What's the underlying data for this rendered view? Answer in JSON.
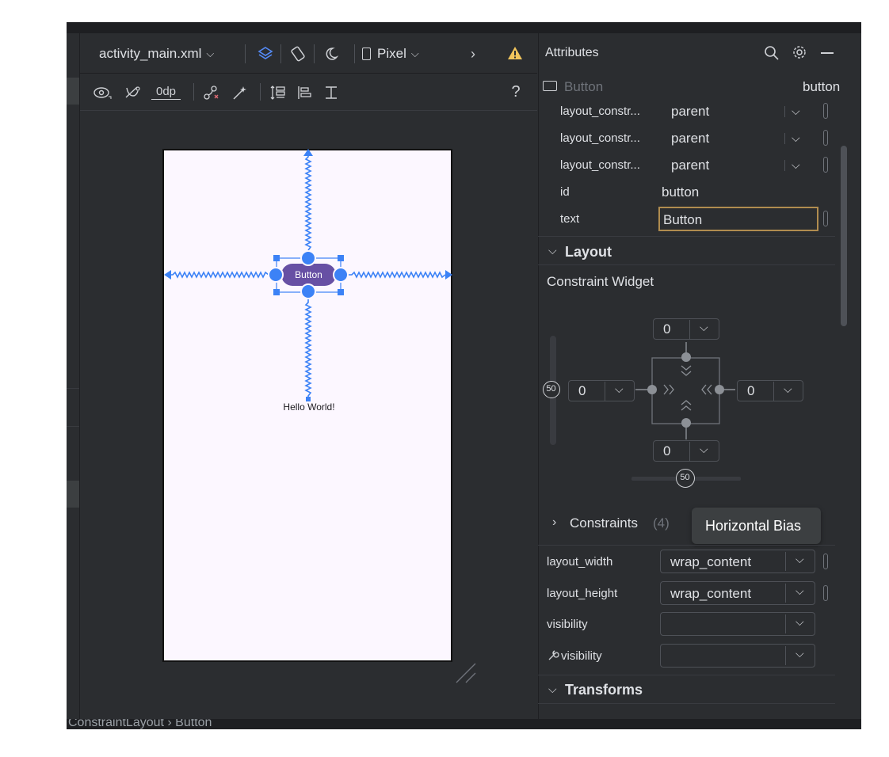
{
  "status_bar": {
    "breadcrumb": "ConstraintLayout  ›  Button"
  },
  "design_toolbar": {
    "file_name": "activity_main.xml",
    "device": "Pixel",
    "more": "›",
    "margin_value": "0dp",
    "help": "?"
  },
  "canvas": {
    "button_label": "Button",
    "text_label": "Hello World!",
    "colors": {
      "button": "#6750a4",
      "constraint": "#3c82f6",
      "screen": "#fcf7ff"
    }
  },
  "attributes": {
    "title": "Attributes",
    "component_type": "Button",
    "component_id": "button",
    "rows": [
      {
        "name": "layout_constr...",
        "value": "parent"
      },
      {
        "name": "layout_constr...",
        "value": "parent"
      },
      {
        "name": "layout_constr...",
        "value": "parent"
      }
    ],
    "id_label": "id",
    "id_value": "button",
    "text_label": "text",
    "text_value": "Button",
    "layout_section": "Layout",
    "constraint_widget_title": "Constraint Widget",
    "widget": {
      "top_margin": "0",
      "left_margin": "0",
      "right_margin": "0",
      "bottom_margin": "0",
      "vertical_bias": "50",
      "horizontal_bias": "50"
    },
    "constraints_label": "Constraints",
    "constraints_count": "(4)",
    "tooltip": "Horizontal Bias",
    "layout_width_label": "layout_width",
    "layout_width_value": "wrap_content",
    "layout_height_label": "layout_height",
    "layout_height_value": "wrap_content",
    "visibility_label": "visibility",
    "tools_visibility_label": "visibility",
    "transforms_section": "Transforms"
  }
}
